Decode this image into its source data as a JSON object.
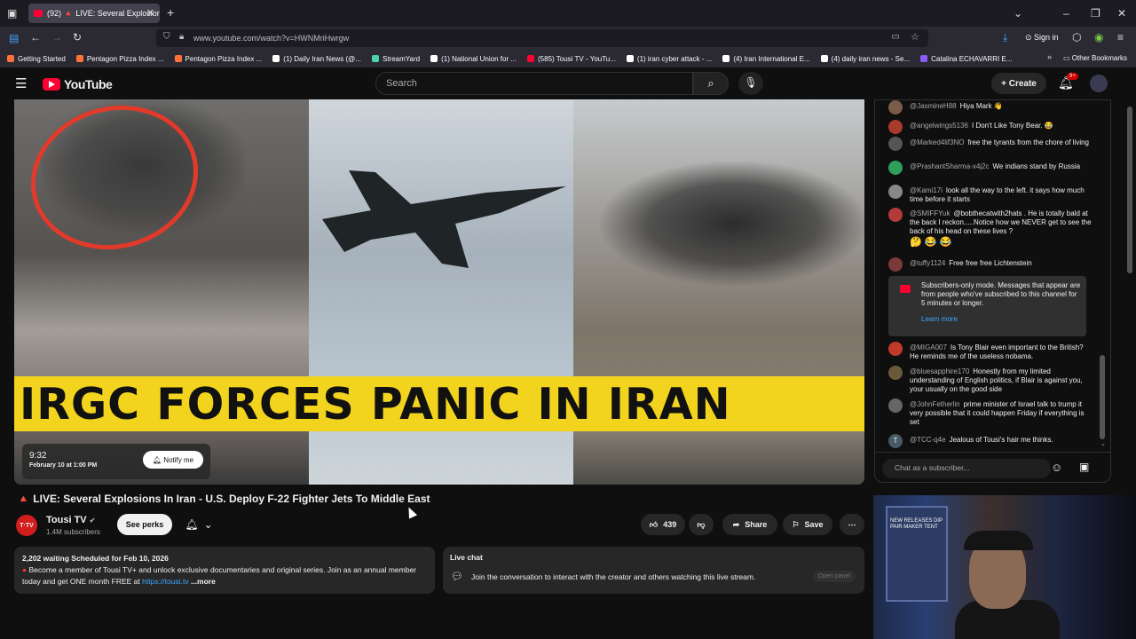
{
  "browser": {
    "tab_title": "(92) 🔺 LIVE: Several Explosion",
    "tab_close": "✕",
    "new_tab": "+",
    "url": "www.youtube.com/watch?v=HWNMriHwrgw",
    "sign_in": "Sign in",
    "bookmarks": [
      {
        "label": "Getting Started",
        "color": "#ff7139"
      },
      {
        "label": "Pentagon Pizza Index ...",
        "color": "#ff7139"
      },
      {
        "label": "Pentagon Pizza Index ...",
        "color": "#ff7139"
      },
      {
        "label": "(1) Daily Iran News (@...",
        "color": "#ffffff"
      },
      {
        "label": "StreamYard",
        "color": "#4ad4a7"
      },
      {
        "label": "(1) National Union for ...",
        "color": "#ffffff"
      },
      {
        "label": "(585) Tousi TV - YouTu...",
        "color": "#ff0033"
      },
      {
        "label": "(1) iran cyber attack - ...",
        "color": "#ffffff"
      },
      {
        "label": "(4) Iran International E...",
        "color": "#ffffff"
      },
      {
        "label": "(4) daily iran news - Se...",
        "color": "#ffffff"
      },
      {
        "label": "Catalina ECHAVARRI E...",
        "color": "#8b5cf6"
      }
    ],
    "other_bookmarks": "Other Bookmarks"
  },
  "youtube": {
    "logo": "YouTube",
    "search_placeholder": "Search",
    "create_label": "Create",
    "notif_count": "9+"
  },
  "video": {
    "banner_text": "IRGC FORCES PANIC IN IRAN",
    "schedule_time": "9:32",
    "schedule_date": "February 10 at 1:00 PM",
    "notify_label": "Notify me",
    "title": "🔺 LIVE: Several Explosions In Iran - U.S. Deploy F-22 Fighter Jets To Middle East",
    "channel_name": "Tousi TV",
    "channel_avatar_text": "T·TV",
    "subscribers": "1.4M subscribers",
    "perks_label": "See perks",
    "likes": "439",
    "share_label": "Share",
    "save_label": "Save"
  },
  "description": {
    "stats": "2,202 waiting  Scheduled for Feb 10, 2026",
    "text": "Become a member of Tousi TV+ and unlock exclusive documentaries and original series. Join as an annual member today and get ONE month FREE at",
    "link": "https://tousi.tv",
    "more": "...more"
  },
  "livechat_panel": {
    "heading": "Live chat",
    "message": "Join the conversation to interact with the creator and others watching this live stream.",
    "open_panel": "Open panel"
  },
  "chat": {
    "messages": [
      {
        "user": "@JasmineH88",
        "text": "Hiya Mark 👋",
        "color": "#7b5c49"
      },
      {
        "user": "@angelwings5136",
        "text": "I Don't Like Tony Bear. 😂",
        "color": "#a83a2a"
      },
      {
        "user": "@Marked4lif3NO",
        "text": "free the tyrants from the chore of living",
        "color": "#555555"
      },
      {
        "user": "@PrashantSharma-x4j2c",
        "text": "We indians stand by Russia",
        "color": "#2e9e5b"
      },
      {
        "user": "@Kami17i",
        "text": "look all the way to the left. it says how much time before it starts",
        "color": "#888888"
      },
      {
        "user": "@SMIFFYuk",
        "text": "@bobthecatwith2hats . He is totally bald at the back I reckon.....Notice how we NEVER get to see the back of his head on these lives ?",
        "emoji": "🤔 😂 😂",
        "color": "#b23a3a"
      },
      {
        "user": "@tuffy1124",
        "text": "Free free free Lichtenstein",
        "color": "#7a3a3a"
      },
      {
        "user": "@MIGA007",
        "text": "Is Tony Blair even important to the British? He reminds me of the useless nobama.",
        "color": "#c0392b"
      },
      {
        "user": "@bluesapphire170",
        "text": "Honestly from my limited understanding of English politics, if Blair is against you, your usually on the good side",
        "color": "#6a5a3a"
      },
      {
        "user": "@JohnFetherlin",
        "text": "prime minister of Israel talk to trump it very possible that it could happen Friday if everything is set",
        "color": "#666666"
      },
      {
        "user": "@TCC-q4e",
        "text": "Jealous of Tousi's hair me thinks.",
        "avatar_letter": "T",
        "color": "#455a64"
      }
    ],
    "notice_text": "Subscribers-only mode. Messages that appear are from people who've subscribed to this channel for 5 minutes or longer.",
    "notice_link": "Learn more",
    "input_placeholder": "Chat as a subscriber..."
  },
  "webcam": {
    "poster_text": "NEW RELEASES  DIP PAIR MAKER TENT"
  }
}
